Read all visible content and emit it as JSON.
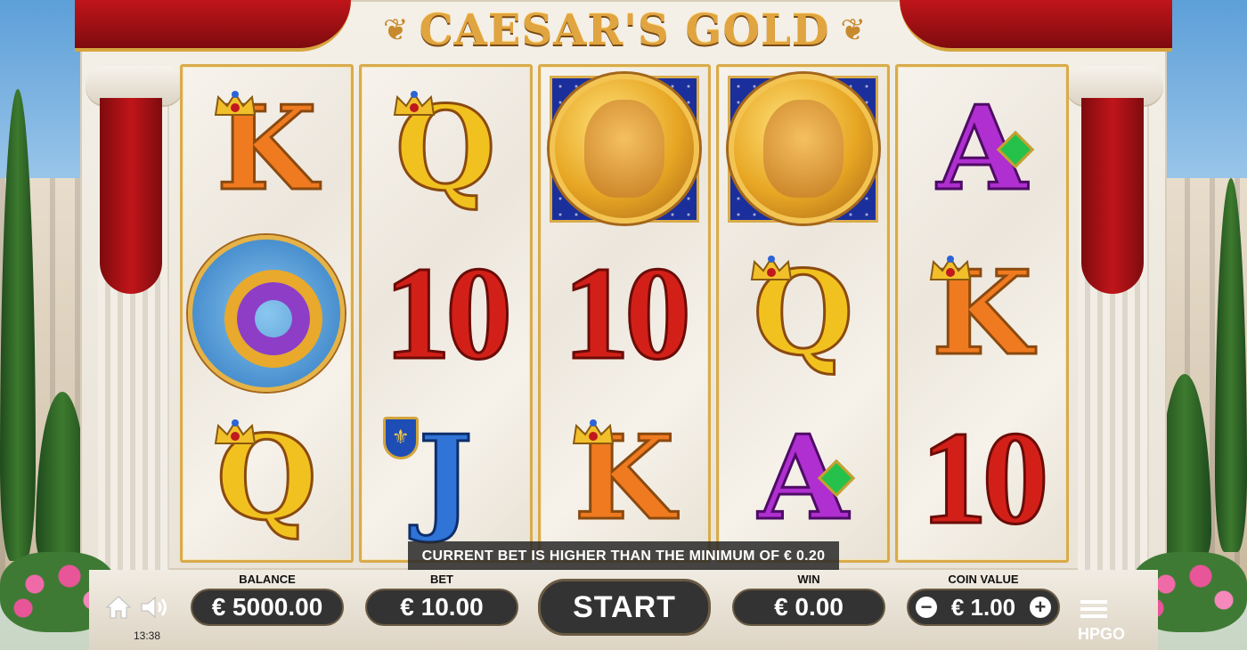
{
  "game": {
    "title": "CAESAR'S GOLD"
  },
  "reels": [
    [
      "K",
      "ring",
      "Q"
    ],
    [
      "Q",
      "10",
      "J"
    ],
    [
      "coin",
      "10",
      "K"
    ],
    [
      "coin",
      "Q",
      "A"
    ],
    [
      "A",
      "K",
      "10"
    ]
  ],
  "symbols": {
    "K": "K",
    "Q": "Q",
    "J": "J",
    "A": "A",
    "ten": "10"
  },
  "message": "CURRENT BET IS HIGHER THAN THE MINIMUM OF € 0.20",
  "controls": {
    "balance_label": "BALANCE",
    "balance_value": "€ 5000.00",
    "bet_label": "BET",
    "bet_value": "€ 10.00",
    "start_label": "START",
    "win_label": "WIN",
    "win_value": "€ 0.00",
    "coin_label": "COIN VALUE",
    "coin_value": "€ 1.00",
    "minus": "−",
    "plus": "+"
  },
  "status": {
    "time": "13:38",
    "brand": "HPGO"
  },
  "icons": {
    "home": "home-icon",
    "sound": "speaker-icon",
    "menu": "hamburger-menu-icon"
  },
  "colors": {
    "curtain": "#c0151a",
    "gold": "#d9ab4b",
    "button": "#333333"
  }
}
